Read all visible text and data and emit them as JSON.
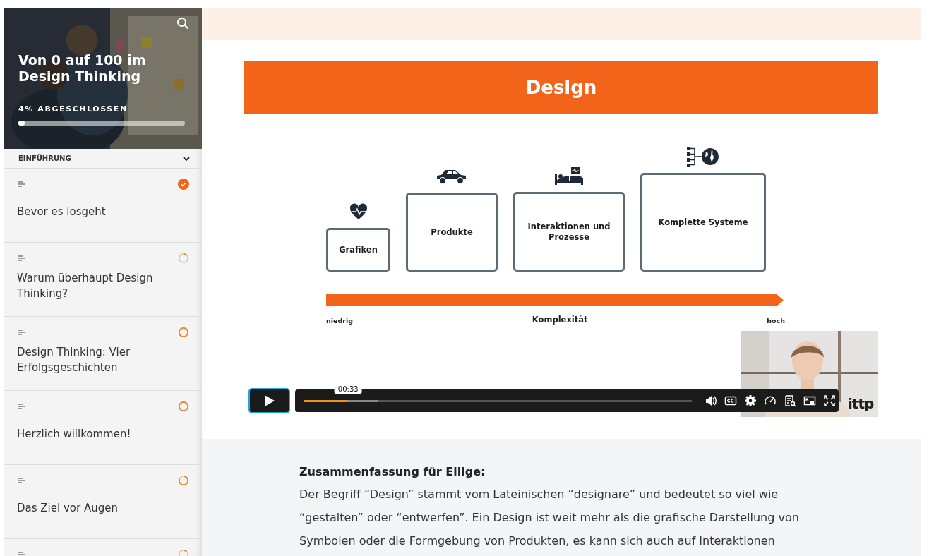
{
  "sidebar": {
    "course_title": "Von 0 auf 100 im Design Thinking",
    "progress_label": "4% ABGESCHLOSSEN",
    "progress": {
      "level": 0.04
    },
    "section": {
      "title": "EINFÜHRUNG",
      "expanded": true
    },
    "lessons": [
      {
        "title": "Bevor es losgeht",
        "kind": "completed"
      },
      {
        "title": "Warum überhaupt Design Thinking?",
        "kind": "started"
      },
      {
        "title": "Design Thinking: Vier Erfolgsgeschichten",
        "kind": "open"
      },
      {
        "title": "Herzlich willkommen!",
        "kind": "open"
      },
      {
        "title": "Das Ziel vor Augen",
        "kind": "partial"
      },
      {
        "kind": "started"
      }
    ]
  },
  "slide": {
    "title": "Design",
    "stages": [
      {
        "label": "Grafiken",
        "kind": "heart"
      },
      {
        "label": "Produkte",
        "kind": "car"
      },
      {
        "label": "Interaktionen und Prozesse",
        "kind": "bed"
      },
      {
        "label": "Komplette Systeme",
        "kind": "globe"
      }
    ],
    "axis": {
      "low": "niedrig",
      "label": "Komplexität",
      "high": "hoch"
    }
  },
  "player": {
    "playing": false,
    "time_tooltip": "00:33",
    "played": {
      "level": 0.115
    },
    "buffered": {
      "level": 0.19
    },
    "logo": "ittp"
  },
  "summary": {
    "heading": "Zusammenfassung für Eilige:",
    "text": "Der Begriff “Design” stammt vom Lateinischen “designare” und bedeutet so viel wie “gestalten” oder “entwerfen”. Ein Design ist weit mehr als die grafische Darstellung von Symbolen oder die Formgebung von Produkten, es kann sich auch auf Interaktionen"
  }
}
